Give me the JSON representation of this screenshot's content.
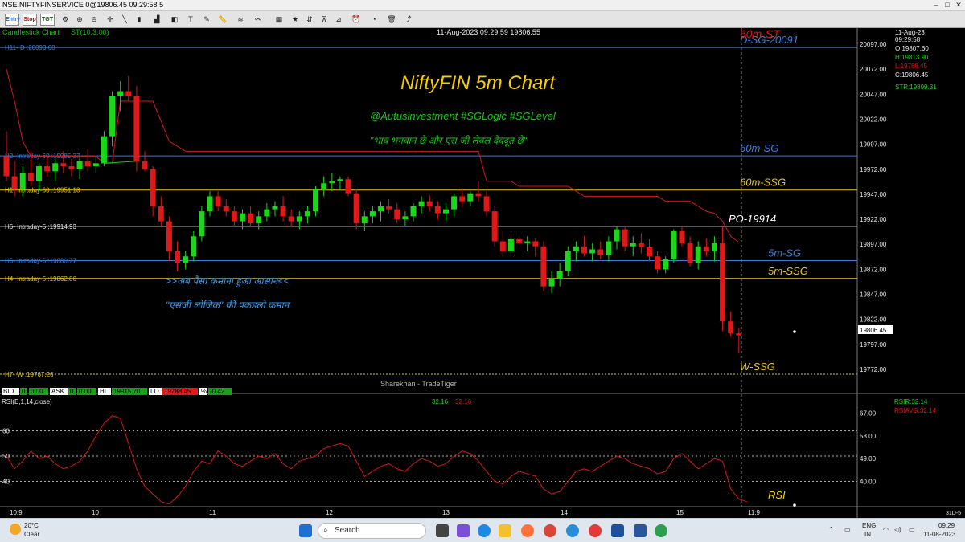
{
  "window": {
    "title": "NSE.NIFTYFINSERVICE 0@19806.45 09:29:58 5",
    "controls": [
      "–",
      "□",
      "✕"
    ]
  },
  "toolbar": {
    "badges": [
      {
        "label": "Entry",
        "color": "#1f5fbf"
      },
      {
        "label": "Stop",
        "color": "#c00000"
      },
      {
        "label": "TGT",
        "color": "#006000"
      }
    ],
    "tools": [
      "settings-icon",
      "zoom-in-icon",
      "zoom-out-icon",
      "crosshair-icon",
      "line-icon",
      "bar-icon",
      "cube-icon",
      "text-icon",
      "pencil-icon",
      "ruler-icon",
      "fib-icon",
      "channel-icon",
      "star-icon",
      "link-icon",
      "delete-icon",
      "bell-icon",
      "trend-icon"
    ]
  },
  "chart": {
    "header_left": "Candlestick Chart",
    "indicator_label": "ST(10,3.00)",
    "header_center": "11-Aug-2023 09:29:59 19806.55",
    "title": "NiftyFIN 5m Chart",
    "handle": "@Autusinvestment  #SGLogic  #SGLevel",
    "quote": "\"भाव भगवान छे और एस जी लेवल देवदूत छे\"",
    "note1": ">>अब पैसा कमाना हुआ आसान<<",
    "note2": "\"एसजी लोजिक\" की पकडलो कमान",
    "watermark": "Sharekhan - TradeTiger",
    "current_price": "19806.45",
    "ohlc": {
      "date": "11-Aug-23",
      "time": "09:29:58",
      "open": "O:19807.60",
      "high": "H:19813.90",
      "low": "L:19788.45",
      "close": "C:19806.45",
      "str": "STR:19899.31"
    },
    "axis_ticks": [
      "20097.00",
      "20072.00",
      "20047.00",
      "20022.00",
      "19997.00",
      "19972.00",
      "19947.00",
      "19922.00",
      "19897.00",
      "19872.00",
      "19847.00",
      "19822.00",
      "19797.00",
      "19772.00"
    ],
    "levels": [
      {
        "left": "H11- D :20093.68",
        "right": "D-SG-20091",
        "price": 20093.68,
        "color": "#3b7dd8",
        "label_color": "#3b7dd8",
        "right_color": "#3b7dd8",
        "dashed": false
      },
      {
        "left": "H2- Intraday-60 :19985.37",
        "right": "60m-SG",
        "price": 19985.37,
        "color": "#3b7dd8",
        "label_color": "#3b7dd8",
        "right_color": "#3b7dd8",
        "dashed": false
      },
      {
        "left": "H1- Intraday-60 :19951.18",
        "right": "60m-SSG",
        "price": 19951.18,
        "color": "#e6c31e",
        "label_color": "#e6c31e",
        "right_color": "#e6c31e",
        "dashed": false
      },
      {
        "left": "H6- Intraday-5 :19914.93",
        "right": "PO-19914",
        "price": 19914.93,
        "color": "#e8e8e8",
        "label_color": "#e8e8e8",
        "right_color": "#ffffff",
        "dashed": false
      },
      {
        "left": "H5- Intraday-5 :19880.77",
        "right": "5m-SG",
        "price": 19880.77,
        "color": "#3b7dd8",
        "label_color": "#3b7dd8",
        "right_color": "#3b7dd8",
        "dashed": false
      },
      {
        "left": "H4- Intraday-5 :19862.86",
        "right": "5m-SSG",
        "price": 19862.86,
        "color": "#e6c31e",
        "label_color": "#e6c31e",
        "right_color": "#e6c31e",
        "dashed": false
      },
      {
        "left": "H7- W :19767.26",
        "right": "W-SSG",
        "price": 19767.26,
        "color": "#e6c31e",
        "label_color": "#e6c31e",
        "right_color": "#e6c31e",
        "dashed": true
      }
    ],
    "top_right_label": "60m-ST",
    "x_labels": [
      "10:9",
      "10",
      "11",
      "12",
      "13",
      "14",
      "15",
      "11:9"
    ],
    "right_corner": "31D-5"
  },
  "status_strip": {
    "items": [
      {
        "k": "BID",
        "v": "0"
      },
      {
        "k": "",
        "v": "0.00"
      },
      {
        "k": "ASK",
        "v": "0"
      },
      {
        "k": "",
        "v": "0.00"
      },
      {
        "k": "HI",
        "v": "19915.70"
      },
      {
        "k": "LO",
        "v": "19788.45"
      },
      {
        "k": "%",
        "v": "-0.42"
      }
    ]
  },
  "rsi": {
    "label": "RSI(E,1,14,close)",
    "values_text": "32.16",
    "values_text2": "32.16",
    "right_rsi": "RSIR:32.14",
    "right_avg": "RSIAVG:32.14",
    "panel_label": "RSI",
    "ticks_right": [
      "67.00",
      "58.00",
      "49.00",
      "40.00"
    ],
    "ticks_left": [
      "60",
      "50",
      "40"
    ]
  },
  "taskbar": {
    "weather_temp": "20°C",
    "weather_desc": "Clear",
    "search_placeholder": "Search",
    "lang": "ENG",
    "region": "IN",
    "time": "09:29",
    "date": "11-08-2023"
  },
  "chart_data": {
    "type": "candlestick",
    "title": "NiftyFIN 5m Chart",
    "x_labels": [
      "10:9",
      "10",
      "11",
      "12",
      "13",
      "14",
      "15",
      "11:9"
    ],
    "ylim": [
      19760,
      20105
    ],
    "candles": [
      [
        19985,
        20010,
        19960,
        19965
      ],
      [
        19965,
        19980,
        19945,
        19952
      ],
      [
        19952,
        19975,
        19945,
        19968
      ],
      [
        19968,
        19990,
        19955,
        19960
      ],
      [
        19960,
        19978,
        19950,
        19975
      ],
      [
        19975,
        19985,
        19965,
        19970
      ],
      [
        19970,
        19982,
        19960,
        19978
      ],
      [
        19978,
        19990,
        19968,
        19975
      ],
      [
        19975,
        19982,
        19965,
        19972
      ],
      [
        19972,
        19985,
        19962,
        19980
      ],
      [
        19980,
        19992,
        19970,
        19975
      ],
      [
        19975,
        19985,
        19968,
        19978
      ],
      [
        19978,
        20010,
        19975,
        20005
      ],
      [
        20005,
        20050,
        19995,
        20045
      ],
      [
        20045,
        20060,
        20030,
        20050
      ],
      [
        20050,
        20065,
        20040,
        20045
      ],
      [
        20045,
        20055,
        19970,
        19980
      ],
      [
        19980,
        19990,
        19970,
        19972
      ],
      [
        19972,
        19975,
        19925,
        19935
      ],
      [
        19935,
        19945,
        19915,
        19920
      ],
      [
        19920,
        19925,
        19880,
        19890
      ],
      [
        19890,
        19900,
        19870,
        19878
      ],
      [
        19878,
        19890,
        19872,
        19885
      ],
      [
        19885,
        19910,
        19880,
        19905
      ],
      [
        19905,
        19935,
        19900,
        19930
      ],
      [
        19930,
        19950,
        19925,
        19945
      ],
      [
        19945,
        19950,
        19930,
        19935
      ],
      [
        19935,
        19942,
        19925,
        19930
      ],
      [
        19930,
        19935,
        19915,
        19920
      ],
      [
        19920,
        19932,
        19912,
        19928
      ],
      [
        19928,
        19935,
        19915,
        19918
      ],
      [
        19918,
        19930,
        19912,
        19925
      ],
      [
        19925,
        19938,
        19920,
        19932
      ],
      [
        19932,
        19940,
        19925,
        19935
      ],
      [
        19935,
        19945,
        19920,
        19925
      ],
      [
        19925,
        19932,
        19915,
        19920
      ],
      [
        19920,
        19930,
        19912,
        19925
      ],
      [
        19925,
        19935,
        19918,
        19930
      ],
      [
        19930,
        19955,
        19925,
        19952
      ],
      [
        19952,
        19965,
        19945,
        19958
      ],
      [
        19958,
        19968,
        19950,
        19960
      ],
      [
        19960,
        19965,
        19952,
        19962
      ],
      [
        19962,
        19965,
        19945,
        19948
      ],
      [
        19948,
        19952,
        19912,
        19918
      ],
      [
        19918,
        19930,
        19910,
        19925
      ],
      [
        19925,
        19935,
        19918,
        19930
      ],
      [
        19930,
        19940,
        19920,
        19935
      ],
      [
        19935,
        19942,
        19928,
        19932
      ],
      [
        19932,
        19938,
        19918,
        19922
      ],
      [
        19922,
        19930,
        19915,
        19925
      ],
      [
        19925,
        19938,
        19920,
        19935
      ],
      [
        19935,
        19945,
        19928,
        19940
      ],
      [
        19940,
        19946,
        19930,
        19935
      ],
      [
        19935,
        19940,
        19922,
        19928
      ],
      [
        19928,
        19938,
        19920,
        19932
      ],
      [
        19932,
        19948,
        19925,
        19945
      ],
      [
        19945,
        19952,
        19935,
        19940
      ],
      [
        19940,
        19950,
        19935,
        19948
      ],
      [
        19948,
        19960,
        19940,
        19945
      ],
      [
        19945,
        19950,
        19925,
        19930
      ],
      [
        19930,
        19935,
        19895,
        19900
      ],
      [
        19900,
        19910,
        19885,
        19890
      ],
      [
        19890,
        19905,
        19885,
        19902
      ],
      [
        19902,
        19908,
        19892,
        19898
      ],
      [
        19898,
        19905,
        19890,
        19900
      ],
      [
        19900,
        19903,
        19885,
        19895
      ],
      [
        19895,
        19900,
        19850,
        19855
      ],
      [
        19855,
        19870,
        19848,
        19862
      ],
      [
        19862,
        19878,
        19855,
        19870
      ],
      [
        19870,
        19895,
        19865,
        19890
      ],
      [
        19890,
        19900,
        19880,
        19895
      ],
      [
        19895,
        19905,
        19885,
        19888
      ],
      [
        19888,
        19898,
        19880,
        19892
      ],
      [
        19892,
        19900,
        19882,
        19886
      ],
      [
        19886,
        19905,
        19880,
        19900
      ],
      [
        19900,
        19915,
        19892,
        19912
      ],
      [
        19912,
        19915,
        19890,
        19895
      ],
      [
        19895,
        19905,
        19885,
        19898
      ],
      [
        19898,
        19908,
        19888,
        19894
      ],
      [
        19894,
        19902,
        19880,
        19885
      ],
      [
        19885,
        19890,
        19868,
        19872
      ],
      [
        19872,
        19885,
        19868,
        19882
      ],
      [
        19882,
        19912,
        19878,
        19910
      ],
      [
        19910,
        19915,
        19895,
        19898
      ],
      [
        19898,
        19905,
        19875,
        19878
      ],
      [
        19878,
        19900,
        19872,
        19895
      ],
      [
        19895,
        19903,
        19885,
        19890
      ],
      [
        19890,
        19905,
        19880,
        19898
      ],
      [
        19898,
        19915,
        19810,
        19820
      ],
      [
        19820,
        19830,
        19805,
        19808
      ],
      [
        19808,
        19814,
        19788,
        19806
      ]
    ],
    "supertrend": [
      20072,
      20040,
      20000,
      19985,
      19985,
      19985,
      19985,
      19985,
      19985,
      19985,
      19985,
      19985,
      19978,
      19978,
      20040,
      20040,
      20040,
      20040,
      20040,
      20020,
      20000,
      19995,
      19990,
      19990,
      19990,
      19990,
      19990,
      19990,
      19990,
      19990,
      19990,
      19990,
      19990,
      19990,
      19990,
      19990,
      19990,
      19990,
      19990,
      19990,
      19990,
      19990,
      19990,
      19990,
      19990,
      19990,
      19990,
      19990,
      19990,
      19990,
      19990,
      19990,
      19990,
      19990,
      19990,
      19990,
      19990,
      19990,
      19990,
      19960,
      19960,
      19960,
      19960,
      19955,
      19955,
      19955,
      19955,
      19955,
      19955,
      19955,
      19950,
      19945,
      19945,
      19945,
      19945,
      19945,
      19945,
      19945,
      19945,
      19945,
      19945,
      19940,
      19940,
      19940,
      19940,
      19935,
      19930,
      19928,
      19920,
      19905,
      19899
    ],
    "rsi_values": [
      50,
      45,
      48,
      52,
      49,
      50,
      47,
      45,
      46,
      48,
      52,
      58,
      63,
      66,
      65,
      55,
      45,
      38,
      35,
      32,
      31,
      34,
      38,
      44,
      48,
      47,
      52,
      50,
      47,
      46,
      48,
      50,
      49,
      51,
      47,
      45,
      48,
      49,
      50,
      53,
      54,
      55,
      54,
      48,
      42,
      44,
      46,
      47,
      45,
      44,
      47,
      49,
      48,
      46,
      47,
      50,
      52,
      51,
      48,
      44,
      40,
      39,
      42,
      44,
      43,
      42,
      37,
      35,
      36,
      40,
      44,
      45,
      44,
      46,
      48,
      50,
      49,
      47,
      46,
      45,
      43,
      44,
      49,
      51,
      48,
      45,
      47,
      49,
      48,
      37,
      33,
      32
    ]
  }
}
